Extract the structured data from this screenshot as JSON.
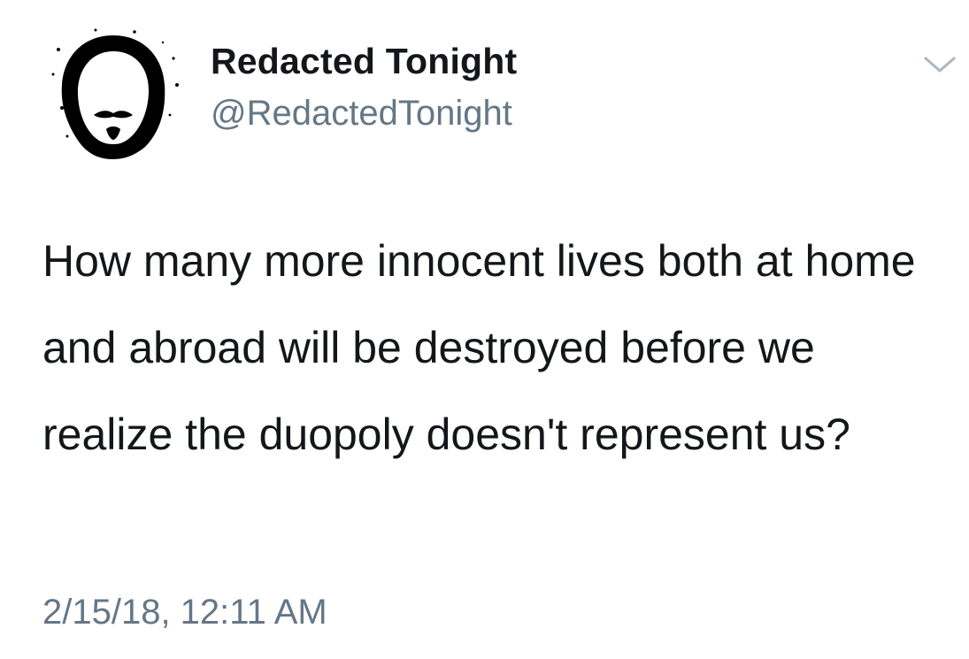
{
  "tweet": {
    "display_name": "Redacted Tonight",
    "handle": "@RedactedTonight",
    "text": "How many more innocent lives both at home and abroad will be destroyed before we realize the duopoly doesn't represent us?",
    "timestamp": "2/15/18, 12:11 AM"
  },
  "icons": {
    "avatar": "face-silhouette-avatar",
    "menu": "chevron-down-icon"
  },
  "colors": {
    "text": "#14171a",
    "secondary": "#657786",
    "chevron": "#aab8c2"
  }
}
